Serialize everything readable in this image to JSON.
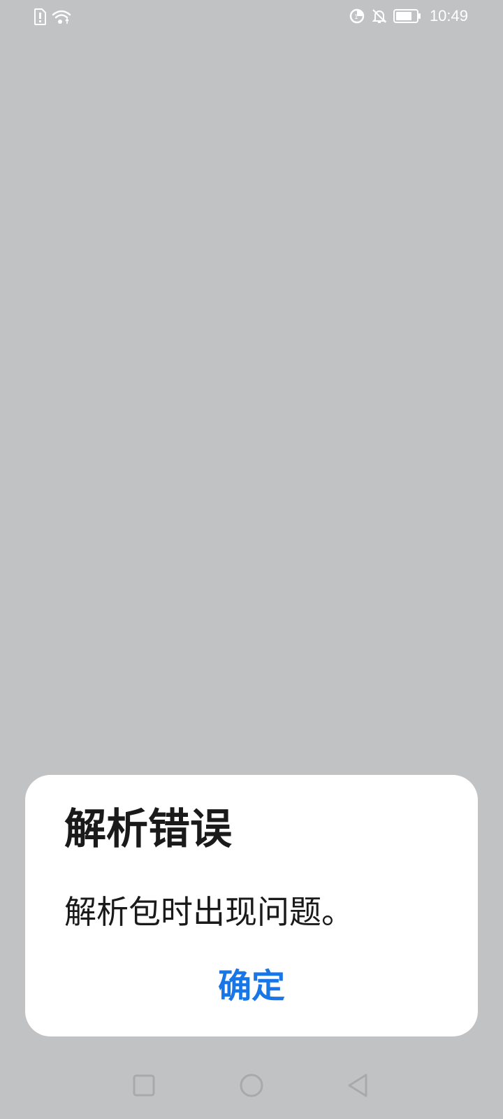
{
  "status_bar": {
    "time": "10:49",
    "left_icons": [
      "sim-alert-icon",
      "wifi-icon"
    ],
    "right_icons": [
      "data-saver-icon",
      "bell-off-icon",
      "battery-icon"
    ]
  },
  "dialog": {
    "title": "解析错误",
    "message": "解析包时出现问题。",
    "confirm_label": "确定"
  },
  "nav_bar": {
    "icons": [
      "recents-square-icon",
      "home-circle-icon",
      "back-triangle-icon"
    ]
  },
  "colors": {
    "scrim": "#c1c2c4",
    "dialog_bg": "#ffffff",
    "title_text": "#1a1a1a",
    "accent": "#1976e6",
    "nav_icon": "#a8a9ab"
  }
}
